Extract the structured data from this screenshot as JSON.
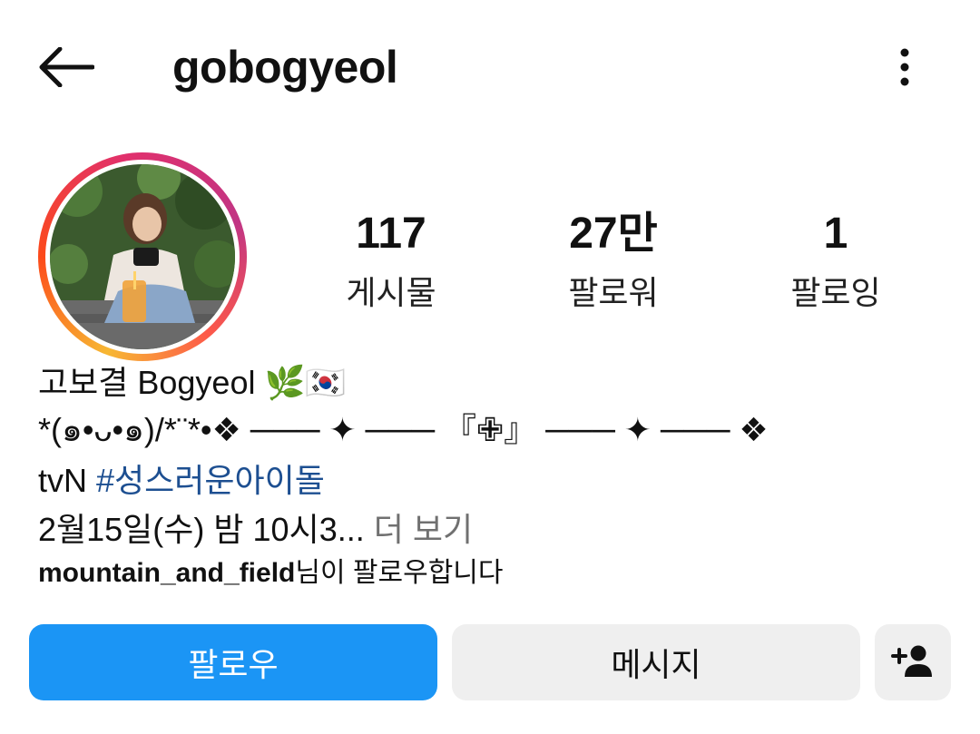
{
  "header": {
    "username": "gobogyeol",
    "back_icon": "arrow-left-icon",
    "more_icon": "vertical-dots-icon"
  },
  "stats": [
    {
      "value": "117",
      "label": "게시물"
    },
    {
      "value": "27만",
      "label": "팔로워"
    },
    {
      "value": "1",
      "label": "팔로잉"
    }
  ],
  "bio": {
    "name": "고보결 Bogyeol",
    "name_emojis": "🌿🇰🇷",
    "decoration": "*(๑•ᴗ•๑)/*¨*•❖ ─── ✦ ─── 『✙』 ─── ✦ ─── ❖",
    "line_tv_prefix": "tvN ",
    "hashtag": "#성스러운아이돌",
    "line_date": "2월15일(수) 밤 10시3...",
    "more_label": " 더 보기",
    "followed_by_user": "mountain_and_field",
    "followed_by_suffix": "님이 팔로우합니다"
  },
  "buttons": {
    "follow_label": "팔로우",
    "message_label": "메시지",
    "add_user_icon": "add-user-icon"
  },
  "colors": {
    "follow_blue": "#1b95f5",
    "hashtag_blue": "#1d4f91",
    "secondary_gray": "#efefef"
  }
}
